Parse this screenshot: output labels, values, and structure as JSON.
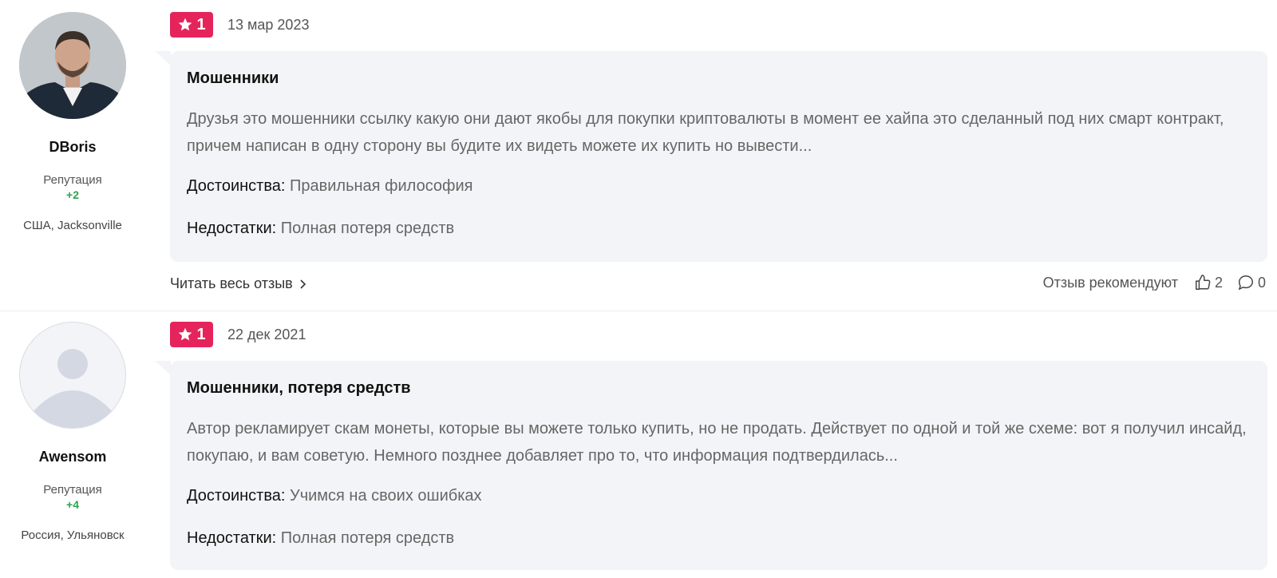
{
  "reviews": [
    {
      "author": {
        "name": "DBoris",
        "reputation_label": "Репутация",
        "reputation_value": "+2",
        "location": "США, Jacksonville",
        "avatar": "user-photo"
      },
      "rating": "1",
      "date": "13 мар 2023",
      "title": "Мошенники",
      "text": "Друзья это мошенники ссылку какую они дают якобы для покупки криптовалюты в момент ее хайпа это сделанный под них смарт контракт, причем написан в одну сторону вы будите их видеть можете их купить но вывести...",
      "pros_label": "Достоинства:",
      "pros": "Правильная философия",
      "cons_label": "Недостатки:",
      "cons": "Полная потеря средств",
      "read_more": "Читать весь отзыв",
      "recommend_label": "Отзыв рекомендуют",
      "likes": "2",
      "comments": "0"
    },
    {
      "author": {
        "name": "Awensom",
        "reputation_label": "Репутация",
        "reputation_value": "+4",
        "location": "Россия, Ульяновск",
        "avatar": "default-avatar"
      },
      "rating": "1",
      "date": "22 дек 2021",
      "title": "Мошенники, потеря средств",
      "text": "Автор рекламирует скам монеты, которые вы можете только купить, но не продать. Действует по одной и той же схеме: вот я получил инсайд, покупаю, и вам советую. Немного позднее добавляет про то, что информация подтвердилась...",
      "pros_label": "Достоинства:",
      "pros": "Учимся на своих ошибках",
      "cons_label": "Недостатки:",
      "cons": "Полная потеря средств"
    }
  ],
  "colors": {
    "badge": "#e5245c",
    "bubble": "#f3f4f7",
    "reputation": "#2ea44f"
  },
  "icons": {
    "rating": "star-icon",
    "read_more": "chevron-right-icon",
    "like": "thumbs-up-icon",
    "comment": "comment-icon"
  }
}
